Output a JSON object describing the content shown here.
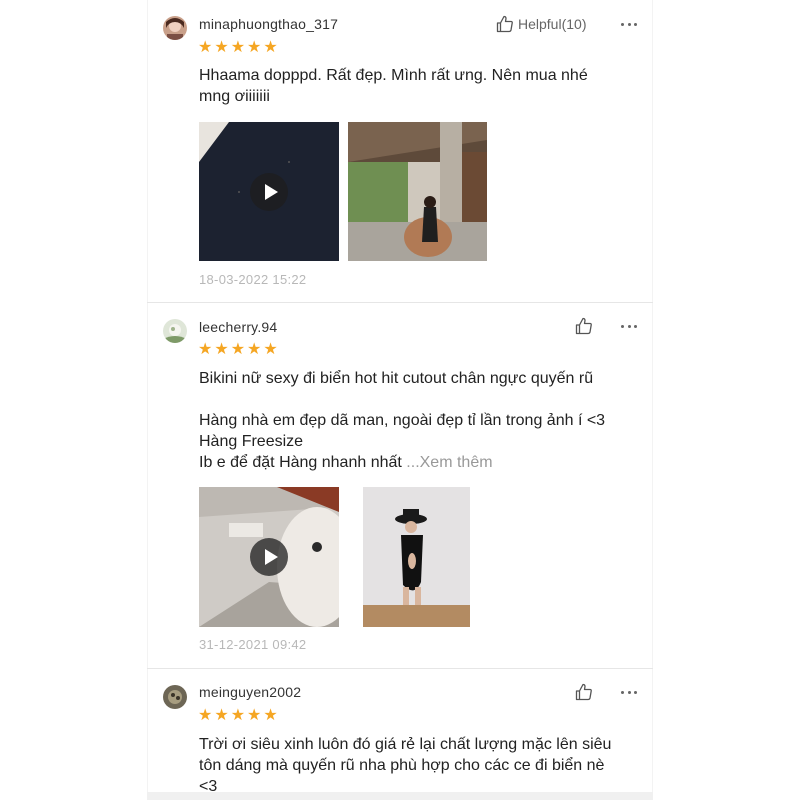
{
  "reviews": [
    {
      "username": "minaphuongthao_317",
      "helpful_label": "Helpful(10)",
      "rating": 5,
      "lines": [
        "Hhaama dopppd. Rất đẹp. Mình rất ưng. Nên mua nhé",
        "mng ơiiiiiii"
      ],
      "date": "18-03-2022 15:22",
      "media": [
        {
          "type": "video"
        },
        {
          "type": "image"
        }
      ]
    },
    {
      "username": "leecherry.94",
      "helpful_label": "",
      "rating": 5,
      "lines": [
        "Bikini nữ sexy đi biển hot hit cutout chân ngực quyến rũ",
        "",
        "Hàng nhà em đẹp dã man, ngoài đẹp tỉ lần trong ảnh í <3",
        "Hàng Freesize",
        "Ib e để đặt Hàng nhanh nhất"
      ],
      "see_more": "...Xem thêm",
      "date": "31-12-2021 09:42",
      "media": [
        {
          "type": "video"
        },
        {
          "type": "image"
        }
      ]
    },
    {
      "username": "meinguyen2002",
      "helpful_label": "",
      "rating": 5,
      "lines": [
        "Trời ơi siêu xinh luôn đó giá rẻ lại chất lượng mặc lên siêu",
        "tôn dáng mà quyến rũ nha phù hợp cho các ce đi biển nè",
        "<3"
      ]
    }
  ],
  "icons": {
    "like": "thumbs-up-icon",
    "more": "more-horizontal-icon",
    "star": "star-icon",
    "play": "play-icon"
  },
  "colors": {
    "star": "#f5a623",
    "date": "#b8b8b8",
    "see_more": "#999999"
  }
}
